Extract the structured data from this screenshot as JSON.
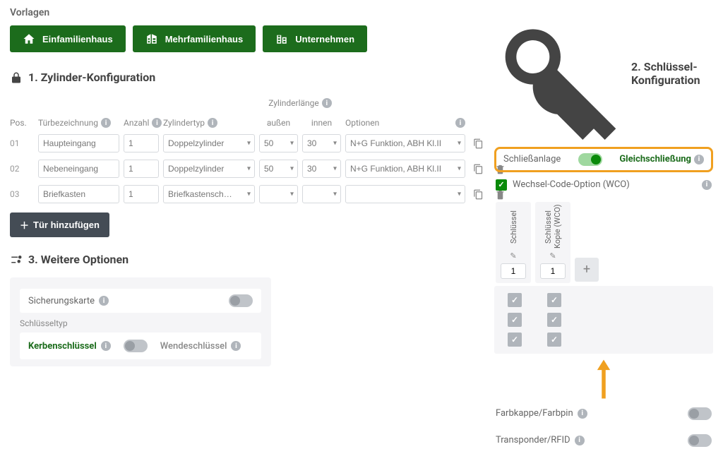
{
  "templates": {
    "title": "Vorlagen",
    "items": [
      "Einfamilienhaus",
      "Mehrfamilienhaus",
      "Unternehmen"
    ]
  },
  "step1": {
    "title": "1. Zylinder-Konfiguration",
    "group_label": "Zylinderlänge",
    "headers": {
      "pos": "Pos.",
      "door": "Türbezeichnung",
      "qty": "Anzahl",
      "type": "Zylindertyp",
      "outer": "außen",
      "inner": "innen",
      "options": "Optionen"
    },
    "rows": [
      {
        "pos": "01",
        "door": "Haupteingang",
        "qty": "1",
        "type": "Doppelzylinder",
        "outer": "50",
        "inner": "30",
        "opts": "N+G Funktion, ABH Kl.II",
        "delete": false
      },
      {
        "pos": "02",
        "door": "Nebeneingang",
        "qty": "1",
        "type": "Doppelzylinder",
        "outer": "50",
        "inner": "30",
        "opts": "N+G Funktion, ABH Kl.II",
        "delete": true
      },
      {
        "pos": "03",
        "door": "Briefkasten",
        "qty": "1",
        "type": "Briefkastensch…",
        "outer": "",
        "inner": "",
        "opts": "",
        "delete": true
      }
    ],
    "add_door": "Tür hinzufügen"
  },
  "step3": {
    "title": "3. Weitere Optionen",
    "security_card": "Sicherungskarte",
    "keytype_label": "Schlüsseltyp",
    "keytype_a": "Kerbenschlüssel",
    "keytype_b": "Wendeschlüssel"
  },
  "step2": {
    "title": "2. Schlüssel-Konfiguration",
    "mode_a": "Schließanlage",
    "mode_b": "Gleichschließung",
    "wco": "Wechsel-Code-Option (WCO)",
    "col1": "Schlüssel",
    "col2": "Schlüssel\nKopie (WCO)",
    "col1_val": "1",
    "col2_val": "1",
    "farbkappe": "Farbkappe/Farbpin",
    "transponder": "Transponder/RFID"
  }
}
